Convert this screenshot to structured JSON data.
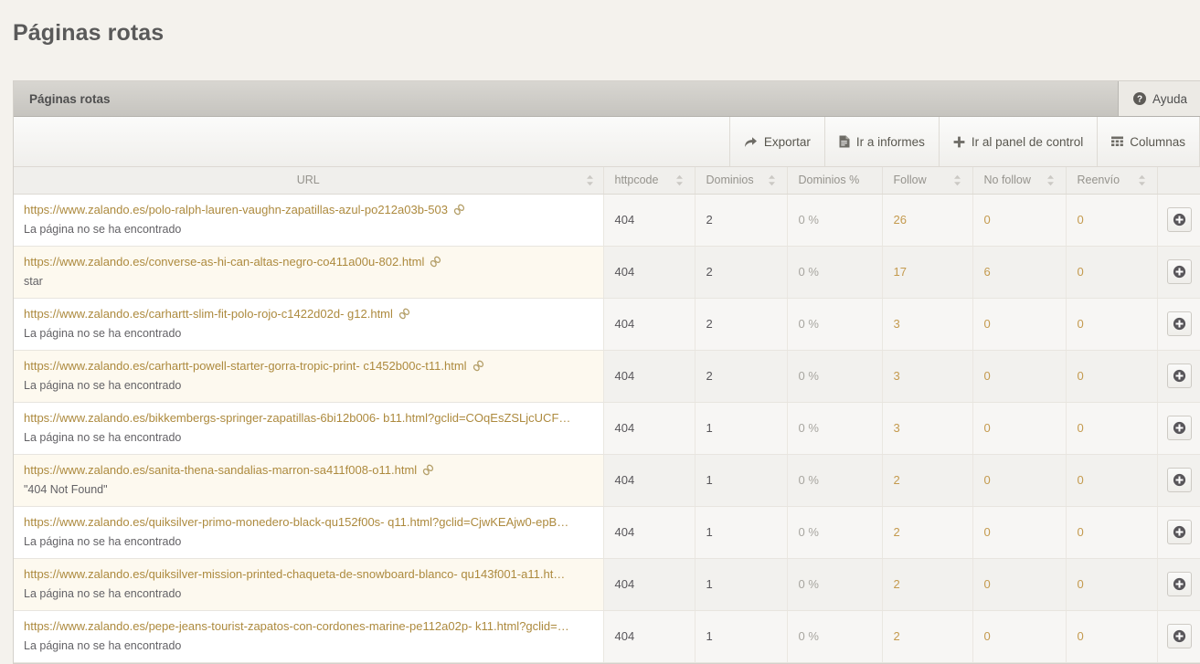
{
  "page": {
    "title": "Páginas rotas"
  },
  "panel": {
    "header_title": "Páginas rotas",
    "help_label": "Ayuda",
    "help_icon": "question-circle-icon"
  },
  "toolbar": {
    "buttons": [
      {
        "label": "Exportar",
        "icon": "share-arrow-icon"
      },
      {
        "label": "Ir a informes",
        "icon": "file-text-icon"
      },
      {
        "label": "Ir al panel de control",
        "icon": "plus-icon"
      },
      {
        "label": "Columnas",
        "icon": "grid-columns-icon"
      }
    ]
  },
  "table": {
    "columns": [
      {
        "key": "url",
        "label": "URL",
        "sortable": true,
        "align": "center"
      },
      {
        "key": "httpcode",
        "label": "httpcode",
        "sortable": true,
        "align": "left"
      },
      {
        "key": "dominios",
        "label": "Dominios",
        "sortable": true,
        "align": "left"
      },
      {
        "key": "dominiospc",
        "label": "Dominios %",
        "sortable": false,
        "align": "left"
      },
      {
        "key": "follow",
        "label": "Follow",
        "sortable": true,
        "align": "left"
      },
      {
        "key": "nofollow",
        "label": "No follow",
        "sortable": true,
        "align": "left"
      },
      {
        "key": "reenvio",
        "label": "Reenvío",
        "sortable": true,
        "align": "left"
      }
    ],
    "row_action": {
      "icon": "plus-circle-icon",
      "name": "expand-row-button"
    },
    "rows": [
      {
        "url": "https://www.zalando.es/polo-ralph-lauren-vaughn-zapatillas-azul-po212a03b-503",
        "has_link_icon": true,
        "note": "La página no se ha encontrado",
        "httpcode": "404",
        "dominios": "2",
        "dominiospc": "0 %",
        "follow": "26",
        "nofollow": "0",
        "reenvio": "0"
      },
      {
        "url": "https://www.zalando.es/converse-as-hi-can-altas-negro-co411a00u-802.html",
        "has_link_icon": true,
        "note": "star",
        "httpcode": "404",
        "dominios": "2",
        "dominiospc": "0 %",
        "follow": "17",
        "nofollow": "6",
        "reenvio": "0"
      },
      {
        "url": "https://www.zalando.es/carhartt-slim-fit-polo-rojo-c1422d02d- g12.html",
        "has_link_icon": true,
        "note": "La página no se ha encontrado",
        "httpcode": "404",
        "dominios": "2",
        "dominiospc": "0 %",
        "follow": "3",
        "nofollow": "0",
        "reenvio": "0"
      },
      {
        "url": "https://www.zalando.es/carhartt-powell-starter-gorra-tropic-print- c1452b00c-t11.html",
        "has_link_icon": true,
        "note": "La página no se ha encontrado",
        "httpcode": "404",
        "dominios": "2",
        "dominiospc": "0 %",
        "follow": "3",
        "nofollow": "0",
        "reenvio": "0"
      },
      {
        "url": "https://www.zalando.es/bikkembergs-springer-zapatillas-6bi12b006- b11.html?gclid=COqEsZSLjcUCF…",
        "has_link_icon": false,
        "note": "La página no se ha encontrado",
        "httpcode": "404",
        "dominios": "1",
        "dominiospc": "0 %",
        "follow": "3",
        "nofollow": "0",
        "reenvio": "0"
      },
      {
        "url": "https://www.zalando.es/sanita-thena-sandalias-marron-sa411f008-o11.html",
        "has_link_icon": true,
        "note": "\"404 Not Found\"",
        "httpcode": "404",
        "dominios": "1",
        "dominiospc": "0 %",
        "follow": "2",
        "nofollow": "0",
        "reenvio": "0"
      },
      {
        "url": "https://www.zalando.es/quiksilver-primo-monedero-black-qu152f00s- q11.html?gclid=CjwKEAjw0-epB…",
        "has_link_icon": false,
        "note": "La página no se ha encontrado",
        "httpcode": "404",
        "dominios": "1",
        "dominiospc": "0 %",
        "follow": "2",
        "nofollow": "0",
        "reenvio": "0"
      },
      {
        "url": "https://www.zalando.es/quiksilver-mission-printed-chaqueta-de-snowboard-blanco- qu143f001-a11.ht…",
        "has_link_icon": false,
        "note": "La página no se ha encontrado",
        "httpcode": "404",
        "dominios": "1",
        "dominiospc": "0 %",
        "follow": "2",
        "nofollow": "0",
        "reenvio": "0"
      },
      {
        "url": "https://www.zalando.es/pepe-jeans-tourist-zapatos-con-cordones-marine-pe112a02p- k11.html?gclid=…",
        "has_link_icon": false,
        "note": "La página no se ha encontrado",
        "httpcode": "404",
        "dominios": "1",
        "dominiospc": "0 %",
        "follow": "2",
        "nofollow": "0",
        "reenvio": "0"
      }
    ]
  },
  "colors": {
    "page_bg": "#f4f2ed",
    "link": "#ad8a3e",
    "number_accent": "#c49a4e",
    "panel_header": "#cfcdc8"
  }
}
